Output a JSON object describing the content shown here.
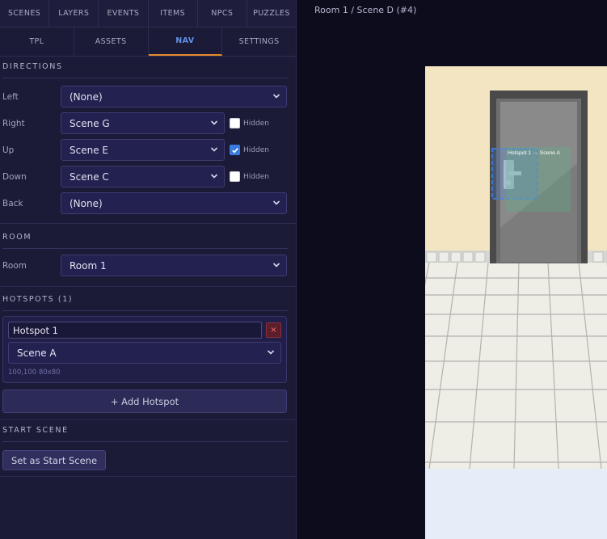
{
  "tabs_main": [
    "SCENES",
    "LAYERS",
    "EVENTS",
    "ITEMS",
    "NPCS",
    "PUZZLES"
  ],
  "tabs_sub": [
    "TPL",
    "ASSETS",
    "NAV",
    "SETTINGS"
  ],
  "tabs_sub_active": "NAV",
  "directions": {
    "title": "DIRECTIONS",
    "rows": [
      {
        "label": "Left",
        "value": "(None)"
      },
      {
        "label": "Right",
        "value": "Scene G",
        "hidden_label": "Hidden",
        "hidden_checked": false
      },
      {
        "label": "Up",
        "value": "Scene E",
        "hidden_label": "Hidden",
        "hidden_checked": true
      },
      {
        "label": "Down",
        "value": "Scene C",
        "hidden_label": "Hidden",
        "hidden_checked": false
      },
      {
        "label": "Back",
        "value": "(None)"
      }
    ]
  },
  "room": {
    "title": "ROOM",
    "label": "Room",
    "value": "Room 1"
  },
  "hotspots": {
    "title": "HOTSPOTS (1)",
    "items": [
      {
        "name": "Hotspot 1",
        "delete": "×",
        "target": "Scene A",
        "meta": "100,100 80x80"
      }
    ],
    "add_label": "+ Add Hotspot"
  },
  "start_scene": {
    "title": "START SCENE",
    "button": "Set as Start Scene"
  },
  "breadcrumb": "Room 1 / Scene D (#4)",
  "preview": {
    "hotspot_label": "Hotspot 1 → Scene A",
    "hotspot_color": "#3b82f6"
  },
  "colors": {
    "accent": "#5f92e6",
    "active_underline": "#e58b2c",
    "panel": "#1b1a37",
    "wall": "#f3e5c2"
  }
}
